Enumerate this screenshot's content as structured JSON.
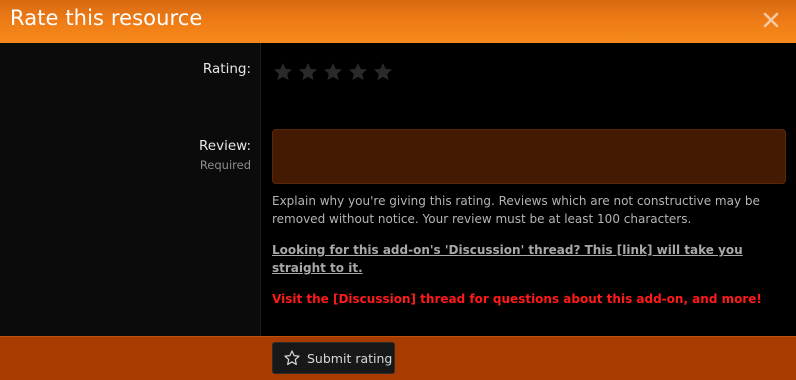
{
  "dialog": {
    "title": "Rate this resource",
    "close_icon": "close-icon",
    "accent_color": "#f07d16"
  },
  "rating": {
    "label": "Rating:",
    "star_icon": "star-icon",
    "max_stars": 5,
    "selected": 0
  },
  "review": {
    "label": "Review:",
    "hint": "Required",
    "value": "",
    "explain_text": "Explain why you're giving this rating. Reviews which are not constructive may be removed without notice. Your review must be at least 100 characters.",
    "discussion_link_text": "Looking for this add-on's 'Discussion' thread? This [link] will take you straight to it.",
    "visit_text": "Visit the [Discussion] thread for questions about this add-on, and more!"
  },
  "footer": {
    "submit_label": "Submit rating",
    "submit_icon": "star-outline-icon",
    "background_color": "#a83c00"
  }
}
